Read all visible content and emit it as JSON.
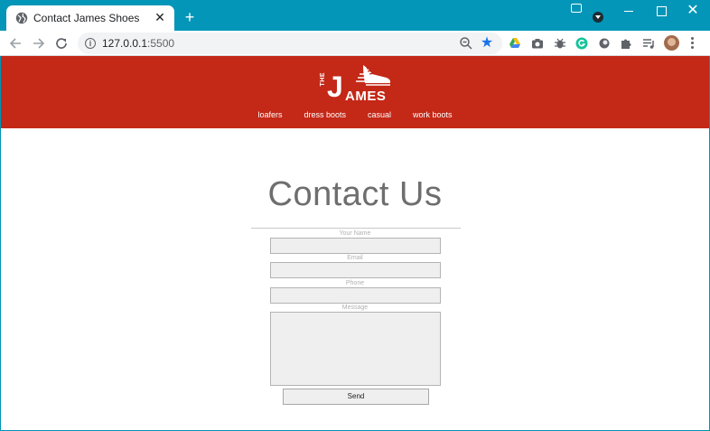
{
  "browser": {
    "tab_title": "Contact James Shoes",
    "tab_close": "✕",
    "new_tab": "+",
    "url_host": "127.0.0.1",
    "url_port": ":5500",
    "icons": [
      "globe-icon",
      "back-arrow-icon",
      "forward-arrow-icon",
      "reload-icon",
      "info-icon",
      "zoom-icon",
      "star-icon",
      "google-drive-icon",
      "camera-icon",
      "bug-icon",
      "grammarly-icon",
      "circle-extension-icon",
      "puzzle-icon",
      "playlist-icon",
      "avatar",
      "kebab-menu-icon"
    ],
    "accent": "#0396b8",
    "star_color": "#1a73e8"
  },
  "site": {
    "brand_color": "#c42817",
    "logo": {
      "the": "THE",
      "j": "J",
      "ames": "AMES"
    },
    "nav": [
      "loafers",
      "dress boots",
      "casual",
      "work boots"
    ]
  },
  "contact": {
    "title": "Contact Us",
    "labels": {
      "name": "Your Name",
      "email": "Email",
      "phone": "Phone",
      "message": "Message"
    },
    "values": {
      "name": "",
      "email": "",
      "phone": "",
      "message": ""
    },
    "send_label": "Send"
  }
}
